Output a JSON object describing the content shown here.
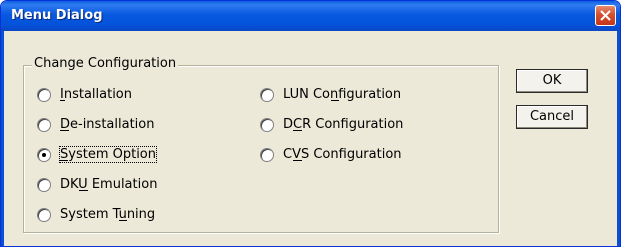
{
  "window": {
    "title": "Menu Dialog"
  },
  "group": {
    "label": "Change Configuration"
  },
  "options": {
    "installation": "Installation",
    "de_installation": "De-installation",
    "system_option": "System Option",
    "dku_emulation": "DKU Emulation",
    "system_tuning": "System Tuning",
    "lun_configuration": "LUN Configuration",
    "dcr_configuration": "DCR Configuration",
    "cvs_configuration": "CVS Configuration"
  },
  "selected": "System Option",
  "buttons": {
    "ok": "OK",
    "cancel": "Cancel"
  },
  "colors": {
    "titlebar": "#0a58dc",
    "close": "#d4512f",
    "face": "#ece9d8"
  }
}
